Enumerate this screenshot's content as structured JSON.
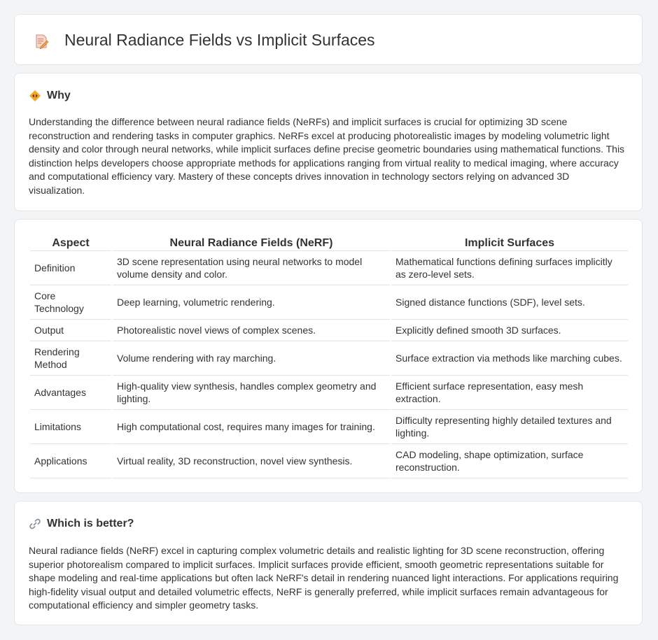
{
  "page": {
    "title": "Neural Radiance Fields vs Implicit Surfaces",
    "title_icon": "document-pencil-icon"
  },
  "why": {
    "title": "Why",
    "icon": "diamond-arrows-icon",
    "text": "Understanding the difference between neural radiance fields (NeRFs) and implicit surfaces is crucial for optimizing 3D scene reconstruction and rendering tasks in computer graphics. NeRFs excel at producing photorealistic images by modeling volumetric light density and color through neural networks, while implicit surfaces define precise geometric boundaries using mathematical functions. This distinction helps developers choose appropriate methods for applications ranging from virtual reality to medical imaging, where accuracy and computational efficiency vary. Mastery of these concepts drives innovation in technology sectors relying on advanced 3D visualization."
  },
  "table": {
    "headers": [
      "Aspect",
      "Neural Radiance Fields (NeRF)",
      "Implicit Surfaces"
    ],
    "rows": [
      [
        "Definition",
        "3D scene representation using neural networks to model volume density and color.",
        "Mathematical functions defining surfaces implicitly as zero-level sets."
      ],
      [
        "Core Technology",
        "Deep learning, volumetric rendering.",
        "Signed distance functions (SDF), level sets."
      ],
      [
        "Output",
        "Photorealistic novel views of complex scenes.",
        "Explicitly defined smooth 3D surfaces."
      ],
      [
        "Rendering Method",
        "Volume rendering with ray marching.",
        "Surface extraction via methods like marching cubes."
      ],
      [
        "Advantages",
        "High-quality view synthesis, handles complex geometry and lighting.",
        "Efficient surface representation, easy mesh extraction."
      ],
      [
        "Limitations",
        "High computational cost, requires many images for training.",
        "Difficulty representing highly detailed textures and lighting."
      ],
      [
        "Applications",
        "Virtual reality, 3D reconstruction, novel view synthesis.",
        "CAD modeling, shape optimization, surface reconstruction."
      ]
    ]
  },
  "better": {
    "title": "Which is better?",
    "icon": "link-icon",
    "text": "Neural radiance fields (NeRF) excel in capturing complex volumetric details and realistic lighting for 3D scene reconstruction, offering superior photorealism compared to implicit surfaces. Implicit surfaces provide efficient, smooth geometric representations suitable for shape modeling and real-time applications but often lack NeRF's detail in rendering nuanced light interactions. For applications requiring high-fidelity visual output and detailed volumetric effects, NeRF is generally preferred, while implicit surfaces remain advantageous for computational efficiency and simpler geometry tasks."
  }
}
